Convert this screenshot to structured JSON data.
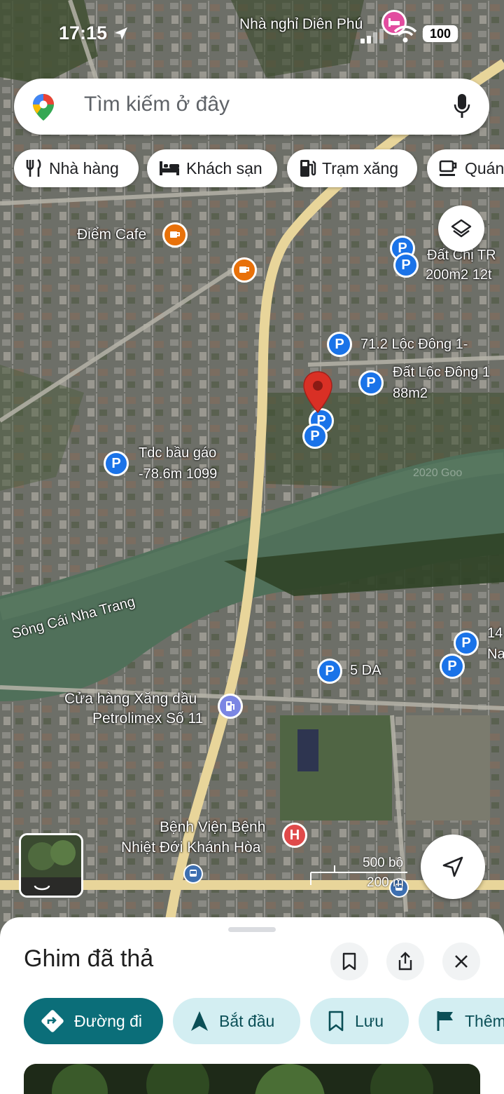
{
  "status": {
    "time": "17:15",
    "battery": "100"
  },
  "search": {
    "placeholder": "Tìm kiếm ở đây"
  },
  "chips": [
    {
      "label": "Nhà hàng",
      "icon": "restaurant-icon"
    },
    {
      "label": "Khách sạn",
      "icon": "hotel-icon"
    },
    {
      "label": "Trạm xăng",
      "icon": "gas-station-icon"
    },
    {
      "label": "Quán",
      "icon": "coffee-icon"
    }
  ],
  "map": {
    "labels": {
      "nha_nghi": "Nhà nghỉ Diên Phú",
      "diem_cafe": "Điểm Cafe",
      "dat_chi": "Đất Chị TR",
      "dat_chi_2": "200m2 12t",
      "loc_dong_1": "71.2 Lộc Đông 1-",
      "dat_loc_dong": "Đất Lộc Đông 1",
      "dat_loc_dong_2": "88m2",
      "tdc_1": "Tdc bầu gáo",
      "tdc_2": "-78.6m 1099",
      "river": "Sông Cái Nha Trang",
      "five_da": "5 DA",
      "right_1": "14",
      "right_2": "Na",
      "petrol_1": "Cửa hàng Xăng dầu",
      "petrol_2": "Petrolimex Số 11",
      "hospital_1": "Bệnh Viện Bệnh",
      "hospital_2": "Nhiệt Đới Khánh Hòa",
      "watermark": "2020 Goo"
    },
    "scale": {
      "feet": "500 bộ",
      "meters": "200 m"
    }
  },
  "sheet": {
    "title": "Ghim đã thả",
    "actions": [
      {
        "label": "Đường đi",
        "icon": "directions-icon"
      },
      {
        "label": "Bắt đầu",
        "icon": "navigation-arrow-icon"
      },
      {
        "label": "Lưu",
        "icon": "bookmark-icon"
      },
      {
        "label": "Thêm",
        "icon": "flag-icon"
      }
    ]
  },
  "colors": {
    "accent": "#0b6e79",
    "chip_bg": "#d3eef2",
    "pin_blue": "#1a73e8",
    "pin_red": "#d93025"
  }
}
